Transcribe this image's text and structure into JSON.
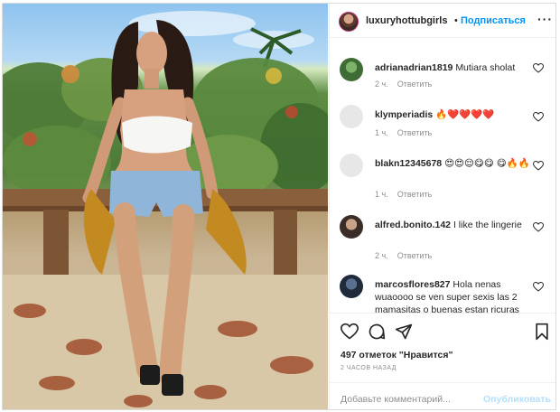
{
  "post": {
    "author": "luxuryhottubgirls",
    "follow_label": "Подписаться",
    "more_label": "···",
    "photo_icon": "photo-of-woman-posing-by-wooden-railing"
  },
  "comments": [
    {
      "username": "adrianadrian1819",
      "text": "Mutiara sholat",
      "time": "2 ч.",
      "reply": "Ответить"
    },
    {
      "username": "klymperiadis",
      "text": "🔥❤️❤️❤️❤️",
      "time": "1 ч.",
      "reply": "Ответить"
    },
    {
      "username": "blakn12345678",
      "text": "😍😍😌😋😋 😋🔥🔥",
      "time": "1 ч.",
      "reply": "Ответить"
    },
    {
      "username": "alfred.bonito.142",
      "text": "I like the lingerie",
      "time": "2 ч.",
      "reply": "Ответить"
    },
    {
      "username": "marcosflores827",
      "text": "Hola nenas wuaoooo se ven super sexis las 2 mamasitas o buenas estan ricuras"
    }
  ],
  "actions": {
    "icons": [
      "heart-icon",
      "comment-icon",
      "share-icon",
      "save-icon"
    ],
    "likes": "497 отметок \"Нравится\"",
    "time": "2 ЧАСОВ НАЗАД"
  },
  "add_comment": {
    "placeholder": "Добавьте комментарий...",
    "publish_label": "Опубликовать"
  },
  "colors": {
    "link_blue": "#0095f6",
    "publish_disabled": "#b2dffc",
    "secondary_text": "#8e8e8e"
  }
}
